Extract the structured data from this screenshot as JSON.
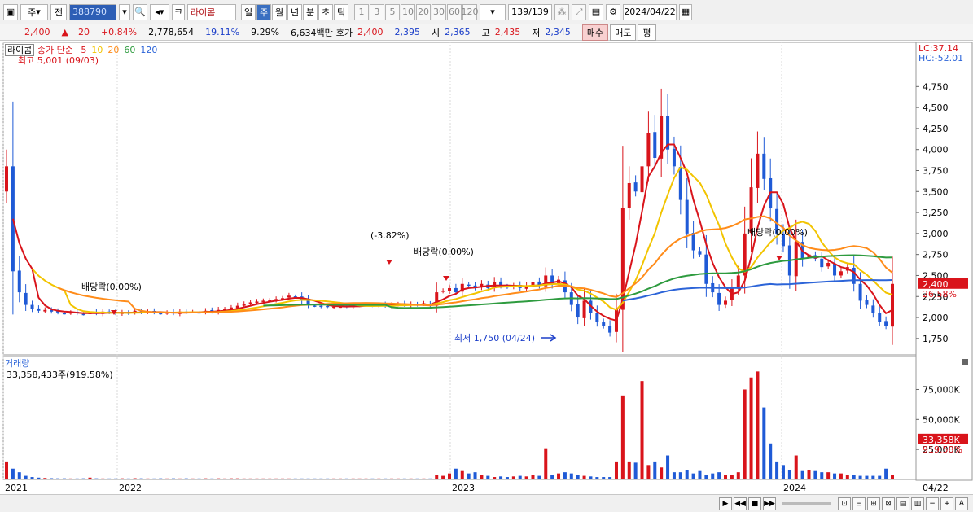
{
  "toolbar": {
    "period_select": "주",
    "jeon_label": "전",
    "code": "388790",
    "market_label": "코",
    "stock_name": "라이콤",
    "periods": [
      "일",
      "주",
      "월",
      "년",
      "분",
      "초",
      "틱"
    ],
    "active_period": "주",
    "intervals": [
      "1",
      "3",
      "5",
      "10",
      "20",
      "30",
      "60",
      "120"
    ],
    "count_display": "139/139",
    "date": "2024/04/22"
  },
  "quote": {
    "price": "2,400",
    "change": "20",
    "change_pct": "+0.84%",
    "volume": "2,778,654",
    "rate1": "19.11%",
    "rate2": "9.29%",
    "amount": "6,634백만",
    "bid_label": "호가",
    "bid1": "2,400",
    "bid2": "2,395",
    "open_label": "시",
    "open": "2,365",
    "high_label": "고",
    "high": "2,435",
    "low_label": "저",
    "low": "2,345",
    "buy_btn": "매수",
    "sell_btn": "매도",
    "eval_btn": "평"
  },
  "price_panel": {
    "name": "라이콤",
    "legend_prefix": "종가 단순",
    "ma_labels": [
      "5",
      "10",
      "20",
      "60",
      "120"
    ],
    "ma_colors": [
      "#d9141b",
      "#f2c400",
      "#ff8c1a",
      "#2e9b3f",
      "#2c64d8"
    ],
    "high_label": "최고 5,001 (09/03)",
    "low_label": "최저 1,750 (04/24)",
    "annotations": [
      "배당락(0.00%)",
      "(-3.82%)",
      "배당락(0.00%)",
      "배당락(0.00%)"
    ],
    "lc": "LC:37.14",
    "hc": "HC:-52.01",
    "price_tag": "2,400",
    "pct_tag": "26.58%",
    "y_ticks": [
      "4,750",
      "4,500",
      "4,250",
      "4,000",
      "3,750",
      "3,500",
      "3,250",
      "3,000",
      "2,750",
      "2,500",
      "2,250",
      "2,000",
      "1,750"
    ]
  },
  "volume_panel": {
    "title": "거래량",
    "value": "33,358,433주(919.58%)",
    "y_ticks": [
      "75,000K",
      "50,000K",
      "25,000K"
    ],
    "tag": "33,358K",
    "tag_pct": "919.58%"
  },
  "x_ticks": [
    "2021",
    "2022",
    "2023",
    "2024"
  ],
  "x_right_label": "04/22",
  "chart_data": {
    "type": "candlestick",
    "x_ticks": [
      "2021",
      "2022",
      "2023",
      "2024"
    ],
    "y_axis_price": {
      "min": 1750,
      "max": 4750
    },
    "y_axis_volume_k": {
      "min": 0,
      "max": 75000
    },
    "moving_averages": [
      "5",
      "10",
      "20",
      "60",
      "120"
    ],
    "close": [
      3800,
      2550,
      2300,
      2150,
      2100,
      2080,
      2090,
      2070,
      2060,
      2050,
      2060,
      2050,
      2040,
      2060,
      2050,
      2070,
      2060,
      2050,
      2060,
      2050,
      2080,
      2060,
      2070,
      2060,
      2050,
      2060,
      2050,
      2070,
      2060,
      2070,
      2060,
      2080,
      2070,
      2090,
      2100,
      2120,
      2140,
      2160,
      2180,
      2190,
      2200,
      2210,
      2220,
      2230,
      2260,
      2250,
      2200,
      2150,
      2140,
      2130,
      2130,
      2130,
      2130,
      2130,
      2140,
      2140,
      2150,
      2140,
      2150,
      2140,
      2150,
      2160,
      2150,
      2160,
      2150,
      2170,
      2140,
      2300,
      2320,
      2350,
      2300,
      2400,
      2380,
      2350,
      2400,
      2350,
      2420,
      2380,
      2360,
      2380,
      2350,
      2380,
      2420,
      2380,
      2500,
      2400,
      2450,
      2300,
      2150,
      2000,
      2200,
      2050,
      1950,
      1900,
      1820,
      2100,
      3300,
      3600,
      3500,
      3800,
      4200,
      3900,
      4400,
      4000,
      3800,
      3400,
      3000,
      2800,
      2750,
      2400,
      2300,
      2150,
      2200,
      2350,
      2500,
      3000,
      3550,
      3950,
      3650,
      3300,
      3000,
      2850,
      2500,
      2900,
      2700,
      2750,
      2700,
      2600,
      2650,
      2500,
      2550,
      2600,
      2400,
      2200,
      2150,
      2050,
      1950,
      1900,
      2400
    ],
    "volume_k": [
      15000,
      9000,
      6000,
      3000,
      2000,
      1500,
      1200,
      1000,
      900,
      900,
      800,
      800,
      900,
      1500,
      900,
      800,
      800,
      800,
      900,
      800,
      1000,
      900,
      800,
      800,
      900,
      800,
      900,
      800,
      900,
      800,
      800,
      900,
      800,
      900,
      800,
      900,
      900,
      800,
      800,
      800,
      800,
      800,
      800,
      800,
      800,
      800,
      800,
      800,
      800,
      800,
      800,
      800,
      800,
      800,
      800,
      800,
      800,
      800,
      800,
      800,
      800,
      800,
      800,
      800,
      800,
      800,
      800,
      4000,
      3000,
      5000,
      9000,
      7000,
      5000,
      6000,
      4000,
      3000,
      2000,
      2500,
      2000,
      2500,
      3000,
      2500,
      3500,
      3000,
      26000,
      4000,
      5000,
      6000,
      5000,
      4000,
      3000,
      2500,
      2000,
      2000,
      2000,
      15000,
      70000,
      15000,
      14000,
      82000,
      12000,
      15000,
      10000,
      20000,
      6000,
      6000,
      8000,
      5000,
      7000,
      4000,
      5000,
      6000,
      4000,
      4000,
      6000,
      75000,
      85000,
      90000,
      60000,
      30000,
      15000,
      12000,
      8000,
      20000,
      7000,
      8000,
      7000,
      6000,
      6000,
      5000,
      5000,
      4000,
      4000,
      3000,
      3000,
      3000,
      3000,
      9000,
      4000,
      5000,
      33358
    ]
  }
}
